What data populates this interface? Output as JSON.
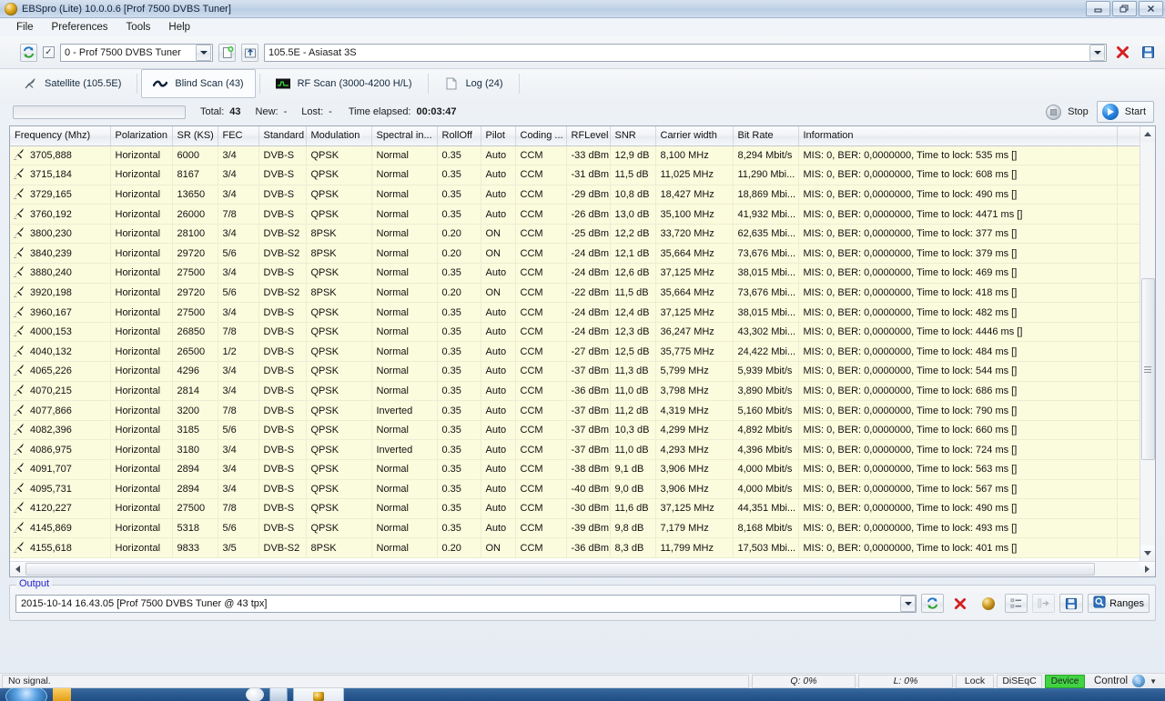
{
  "window": {
    "title": "EBSpro (Lite) 10.0.0.6 [Prof 7500 DVBS Tuner]",
    "minimize_label": "Minimize",
    "restore_label": "Restore",
    "close_label": "Close"
  },
  "menu": {
    "items": [
      {
        "label": "File"
      },
      {
        "label": "Preferences"
      },
      {
        "label": "Tools"
      },
      {
        "label": "Help"
      }
    ]
  },
  "toolbar": {
    "refresh_icon": "refresh-icon",
    "enable_checkbox": "✓",
    "tuner_value": "0 - Prof 7500 DVBS Tuner",
    "new_doc_icon": "new-document-icon",
    "import_icon": "import-icon",
    "satellite_value": "105.5E - Asiasat 3S",
    "delete_icon": "delete-icon",
    "save_icon": "save-icon"
  },
  "tabs": [
    {
      "label": "Satellite (105.5E)",
      "icon": "satellite-dish-icon",
      "active": false
    },
    {
      "label": "Blind Scan (43)",
      "icon": "blind-scan-icon",
      "active": true
    },
    {
      "label": "RF Scan (3000-4200 H/L)",
      "icon": "rf-scan-icon",
      "active": false
    },
    {
      "label": "Log (24)",
      "icon": "log-document-icon",
      "active": false
    }
  ],
  "scan_status": {
    "progress_percent": 0,
    "total_label": "Total:",
    "total_value": "43",
    "new_label": "New:",
    "new_value": "-",
    "lost_label": "Lost:",
    "lost_value": "-",
    "elapsed_label": "Time elapsed:",
    "elapsed_value": "00:03:47",
    "stop_label": "Stop",
    "start_label": "Start"
  },
  "table": {
    "columns": [
      "Frequency (Mhz)",
      "Polarization",
      "SR (KS)",
      "FEC",
      "Standard",
      "Modulation",
      "Spectral in...",
      "RollOff",
      "Pilot",
      "Coding ...",
      "RFLevel",
      "SNR",
      "Carrier width",
      "Bit Rate",
      "Information",
      ""
    ],
    "rows": [
      [
        "3705,888",
        "Horizontal",
        "6000",
        "3/4",
        "DVB-S",
        "QPSK",
        "Normal",
        "0.35",
        "Auto",
        "CCM",
        "-33 dBm",
        "12,9 dB",
        "8,100 MHz",
        "8,294 Mbit/s",
        "MIS: 0, BER: 0,0000000, Time to lock: 535 ms []",
        ""
      ],
      [
        "3715,184",
        "Horizontal",
        "8167",
        "3/4",
        "DVB-S",
        "QPSK",
        "Normal",
        "0.35",
        "Auto",
        "CCM",
        "-31 dBm",
        "11,5 dB",
        "11,025 MHz",
        "11,290 Mbi...",
        "MIS: 0, BER: 0,0000000, Time to lock: 608 ms []",
        ""
      ],
      [
        "3729,165",
        "Horizontal",
        "13650",
        "3/4",
        "DVB-S",
        "QPSK",
        "Normal",
        "0.35",
        "Auto",
        "CCM",
        "-29 dBm",
        "10,8 dB",
        "18,427 MHz",
        "18,869 Mbi...",
        "MIS: 0, BER: 0,0000000, Time to lock: 490 ms []",
        ""
      ],
      [
        "3760,192",
        "Horizontal",
        "26000",
        "7/8",
        "DVB-S",
        "QPSK",
        "Normal",
        "0.35",
        "Auto",
        "CCM",
        "-26 dBm",
        "13,0 dB",
        "35,100 MHz",
        "41,932 Mbi...",
        "MIS: 0, BER: 0,0000000, Time to lock: 4471 ms []",
        ""
      ],
      [
        "3800,230",
        "Horizontal",
        "28100",
        "3/4",
        "DVB-S2",
        "8PSK",
        "Normal",
        "0.20",
        "ON",
        "CCM",
        "-25 dBm",
        "12,2 dB",
        "33,720 MHz",
        "62,635 Mbi...",
        "MIS: 0, BER: 0,0000000, Time to lock: 377 ms []",
        ""
      ],
      [
        "3840,239",
        "Horizontal",
        "29720",
        "5/6",
        "DVB-S2",
        "8PSK",
        "Normal",
        "0.20",
        "ON",
        "CCM",
        "-24 dBm",
        "12,1 dB",
        "35,664 MHz",
        "73,676 Mbi...",
        "MIS: 0, BER: 0,0000000, Time to lock: 379 ms []",
        ""
      ],
      [
        "3880,240",
        "Horizontal",
        "27500",
        "3/4",
        "DVB-S",
        "QPSK",
        "Normal",
        "0.35",
        "Auto",
        "CCM",
        "-24 dBm",
        "12,6 dB",
        "37,125 MHz",
        "38,015 Mbi...",
        "MIS: 0, BER: 0,0000000, Time to lock: 469 ms []",
        ""
      ],
      [
        "3920,198",
        "Horizontal",
        "29720",
        "5/6",
        "DVB-S2",
        "8PSK",
        "Normal",
        "0.20",
        "ON",
        "CCM",
        "-22 dBm",
        "11,5 dB",
        "35,664 MHz",
        "73,676 Mbi...",
        "MIS: 0, BER: 0,0000000, Time to lock: 418 ms []",
        ""
      ],
      [
        "3960,167",
        "Horizontal",
        "27500",
        "3/4",
        "DVB-S",
        "QPSK",
        "Normal",
        "0.35",
        "Auto",
        "CCM",
        "-24 dBm",
        "12,4 dB",
        "37,125 MHz",
        "38,015 Mbi...",
        "MIS: 0, BER: 0,0000000, Time to lock: 482 ms []",
        ""
      ],
      [
        "4000,153",
        "Horizontal",
        "26850",
        "7/8",
        "DVB-S",
        "QPSK",
        "Normal",
        "0.35",
        "Auto",
        "CCM",
        "-24 dBm",
        "12,3 dB",
        "36,247 MHz",
        "43,302 Mbi...",
        "MIS: 0, BER: 0,0000000, Time to lock: 4446 ms []",
        ""
      ],
      [
        "4040,132",
        "Horizontal",
        "26500",
        "1/2",
        "DVB-S",
        "QPSK",
        "Normal",
        "0.35",
        "Auto",
        "CCM",
        "-27 dBm",
        "12,5 dB",
        "35,775 MHz",
        "24,422 Mbi...",
        "MIS: 0, BER: 0,0000000, Time to lock: 484 ms []",
        ""
      ],
      [
        "4065,226",
        "Horizontal",
        "4296",
        "3/4",
        "DVB-S",
        "QPSK",
        "Normal",
        "0.35",
        "Auto",
        "CCM",
        "-37 dBm",
        "11,3 dB",
        "5,799 MHz",
        "5,939 Mbit/s",
        "MIS: 0, BER: 0,0000000, Time to lock: 544 ms []",
        ""
      ],
      [
        "4070,215",
        "Horizontal",
        "2814",
        "3/4",
        "DVB-S",
        "QPSK",
        "Normal",
        "0.35",
        "Auto",
        "CCM",
        "-36 dBm",
        "11,0 dB",
        "3,798 MHz",
        "3,890 Mbit/s",
        "MIS: 0, BER: 0,0000000, Time to lock: 686 ms []",
        ""
      ],
      [
        "4077,866",
        "Horizontal",
        "3200",
        "7/8",
        "DVB-S",
        "QPSK",
        "Inverted",
        "0.35",
        "Auto",
        "CCM",
        "-37 dBm",
        "11,2 dB",
        "4,319 MHz",
        "5,160 Mbit/s",
        "MIS: 0, BER: 0,0000000, Time to lock: 790 ms []",
        ""
      ],
      [
        "4082,396",
        "Horizontal",
        "3185",
        "5/6",
        "DVB-S",
        "QPSK",
        "Normal",
        "0.35",
        "Auto",
        "CCM",
        "-37 dBm",
        "10,3 dB",
        "4,299 MHz",
        "4,892 Mbit/s",
        "MIS: 0, BER: 0,0000000, Time to lock: 660 ms []",
        ""
      ],
      [
        "4086,975",
        "Horizontal",
        "3180",
        "3/4",
        "DVB-S",
        "QPSK",
        "Inverted",
        "0.35",
        "Auto",
        "CCM",
        "-37 dBm",
        "11,0 dB",
        "4,293 MHz",
        "4,396 Mbit/s",
        "MIS: 0, BER: 0,0000000, Time to lock: 724 ms []",
        ""
      ],
      [
        "4091,707",
        "Horizontal",
        "2894",
        "3/4",
        "DVB-S",
        "QPSK",
        "Normal",
        "0.35",
        "Auto",
        "CCM",
        "-38 dBm",
        "9,1 dB",
        "3,906 MHz",
        "4,000 Mbit/s",
        "MIS: 0, BER: 0,0000000, Time to lock: 563 ms []",
        ""
      ],
      [
        "4095,731",
        "Horizontal",
        "2894",
        "3/4",
        "DVB-S",
        "QPSK",
        "Normal",
        "0.35",
        "Auto",
        "CCM",
        "-40 dBm",
        "9,0 dB",
        "3,906 MHz",
        "4,000 Mbit/s",
        "MIS: 0, BER: 0,0000000, Time to lock: 567 ms []",
        ""
      ],
      [
        "4120,227",
        "Horizontal",
        "27500",
        "7/8",
        "DVB-S",
        "QPSK",
        "Normal",
        "0.35",
        "Auto",
        "CCM",
        "-30 dBm",
        "11,6 dB",
        "37,125 MHz",
        "44,351 Mbi...",
        "MIS: 0, BER: 0,0000000, Time to lock: 490 ms []",
        ""
      ],
      [
        "4145,869",
        "Horizontal",
        "5318",
        "5/6",
        "DVB-S",
        "QPSK",
        "Normal",
        "0.35",
        "Auto",
        "CCM",
        "-39 dBm",
        "9,8 dB",
        "7,179 MHz",
        "8,168 Mbit/s",
        "MIS: 0, BER: 0,0000000, Time to lock: 493 ms []",
        ""
      ],
      [
        "4155,618",
        "Horizontal",
        "9833",
        "3/5",
        "DVB-S2",
        "8PSK",
        "Normal",
        "0.20",
        "ON",
        "CCM",
        "-36 dBm",
        "8,3 dB",
        "11,799 MHz",
        "17,503 Mbi...",
        "MIS: 0, BER: 0,0000000, Time to lock: 401 ms []",
        ""
      ]
    ]
  },
  "output": {
    "legend": "Output",
    "log_value": "2015-10-14 16.43.05 [Prof 7500 DVBS Tuner @ 43 tpx]",
    "buttons": [
      {
        "name": "refresh-icon",
        "label": ""
      },
      {
        "name": "delete-icon",
        "label": ""
      },
      {
        "name": "globe-icon",
        "label": ""
      },
      {
        "name": "list-icon",
        "label": ""
      },
      {
        "name": "export-icon",
        "label": ""
      },
      {
        "name": "save-icon",
        "label": ""
      },
      {
        "name": "ranges-icon",
        "label": "Ranges"
      }
    ],
    "ranges_label": "Ranges"
  },
  "statusbar": {
    "message": "No signal.",
    "quality": "Q: 0%",
    "level": "L: 0%",
    "lock": "Lock",
    "diseqc": "DiSEqC",
    "device": "Device",
    "control": "Control"
  },
  "colors": {
    "row_bg": "#fbfbdd",
    "device_green": "#41d342",
    "legend_blue": "#2222cc",
    "accent_blue": "#2b87e0"
  }
}
